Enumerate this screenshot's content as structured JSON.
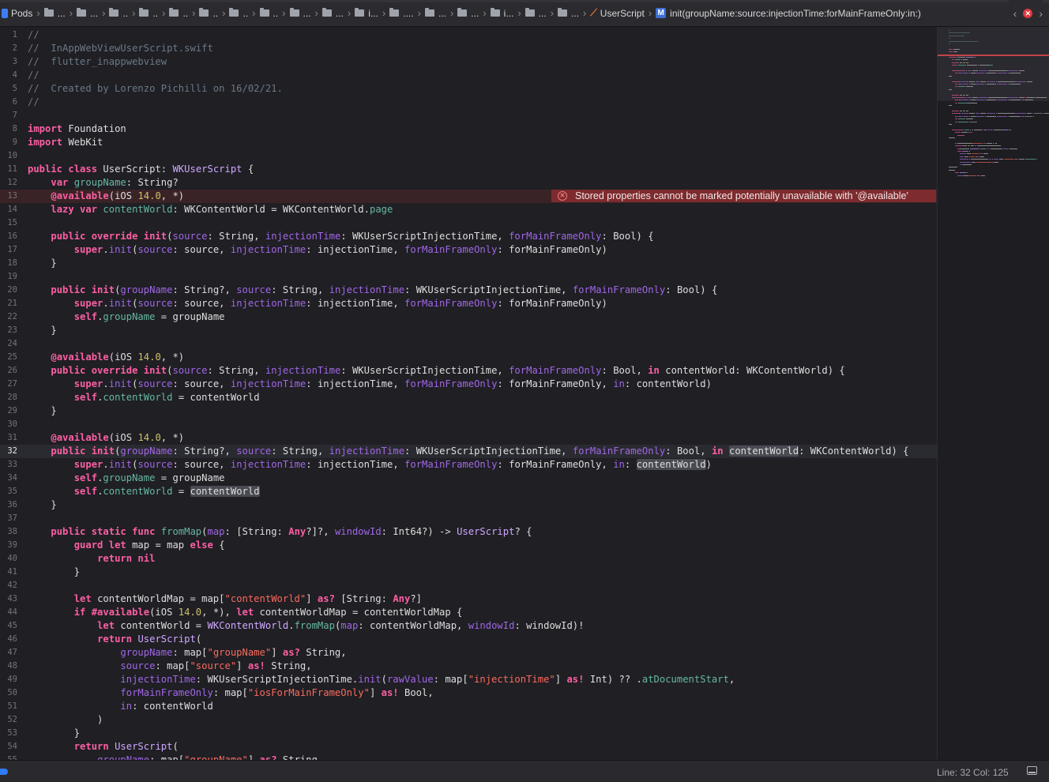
{
  "breadcrumb": {
    "root": "Pods",
    "folders": [
      "...",
      "...",
      "..",
      "..",
      "..",
      "..",
      "..",
      "..",
      "...",
      "...",
      "i...",
      "....",
      "...",
      "...",
      "i...",
      "...",
      "..."
    ],
    "file": "UserScript",
    "symbol": "init(groupName:source:injectionTime:forMainFrameOnly:in:)"
  },
  "error": {
    "line": 13,
    "message": "Stored properties cannot be marked potentially unavailable with '@available'"
  },
  "current_line": 32,
  "status": {
    "position": "Line: 32  Col: 125"
  },
  "colors": {
    "background": "#1f1f24",
    "keyword": "#fc5fa3",
    "comment": "#6c7986",
    "type": "#d0a8ff",
    "string": "#fc6a5d",
    "number": "#d0bf69",
    "error_bg": "#7d2b2e"
  },
  "code": [
    [
      [
        "cm",
        "//"
      ]
    ],
    [
      [
        "cm",
        "//  InAppWebViewUserScript.swift"
      ]
    ],
    [
      [
        "cm",
        "//  flutter_inappwebview"
      ]
    ],
    [
      [
        "cm",
        "//"
      ]
    ],
    [
      [
        "cm",
        "//  Created by Lorenzo Pichilli on 16/02/21."
      ]
    ],
    [
      [
        "cm",
        "//"
      ]
    ],
    [],
    [
      [
        "kw",
        "import"
      ],
      [
        "",
        "Foundation"
      ]
    ],
    [
      [
        "kw",
        "import"
      ],
      [
        "",
        "WebKit"
      ]
    ],
    [],
    [
      [
        "kw",
        "public class"
      ],
      [
        "",
        "UserScript"
      ],
      [
        "",
        ":"
      ],
      [
        "ty",
        "WKUserScript"
      ],
      [
        "",
        "{"
      ]
    ],
    [
      [
        "",
        "    "
      ],
      [
        "kw",
        "var"
      ],
      [
        "pj",
        "groupName"
      ],
      [
        "",
        ":"
      ],
      [
        "",
        "String?"
      ]
    ],
    [
      [
        "",
        "    "
      ],
      [
        "kw",
        "@available"
      ],
      [
        "",
        "(iOS"
      ],
      [
        "nm",
        "14.0"
      ],
      [
        "",
        ", *)"
      ]
    ],
    [
      [
        "",
        "    "
      ],
      [
        "kw",
        "lazy var"
      ],
      [
        "pj",
        "contentWorld"
      ],
      [
        "",
        ":"
      ],
      [
        "",
        "WKContentWorld"
      ],
      [
        "",
        "="
      ],
      [
        "",
        "WKContentWorld."
      ],
      [
        "pj",
        "page"
      ]
    ],
    [],
    [
      [
        "",
        "    "
      ],
      [
        "kw",
        "public override init"
      ],
      [
        "",
        "("
      ],
      [
        "lb",
        "source"
      ],
      [
        "",
        ":"
      ],
      [
        "",
        "String,"
      ],
      [
        "lb",
        "injectionTime"
      ],
      [
        "",
        ":"
      ],
      [
        "",
        "WKUserScriptInjectionTime,"
      ],
      [
        "lb",
        "forMainFrameOnly"
      ],
      [
        "",
        ":"
      ],
      [
        "",
        "Bool) {"
      ]
    ],
    [
      [
        "",
        "        "
      ],
      [
        "kw",
        "super"
      ],
      [
        "",
        "."
      ],
      [
        "lb",
        "init"
      ],
      [
        "",
        "("
      ],
      [
        "lb",
        "source"
      ],
      [
        "",
        ":"
      ],
      [
        "",
        "source,"
      ],
      [
        "lb",
        "injectionTime"
      ],
      [
        "",
        ":"
      ],
      [
        "",
        "injectionTime,"
      ],
      [
        "lb",
        "forMainFrameOnly"
      ],
      [
        "",
        ":"
      ],
      [
        "",
        "forMainFrameOnly)"
      ]
    ],
    [
      [
        "",
        "    }"
      ]
    ],
    [],
    [
      [
        "",
        "    "
      ],
      [
        "kw",
        "public init"
      ],
      [
        "",
        "("
      ],
      [
        "lb",
        "groupName"
      ],
      [
        "",
        ":"
      ],
      [
        "",
        "String?,"
      ],
      [
        "lb",
        "source"
      ],
      [
        "",
        ":"
      ],
      [
        "",
        "String,"
      ],
      [
        "lb",
        "injectionTime"
      ],
      [
        "",
        ":"
      ],
      [
        "",
        "WKUserScriptInjectionTime,"
      ],
      [
        "lb",
        "forMainFrameOnly"
      ],
      [
        "",
        ":"
      ],
      [
        "",
        "Bool) {"
      ]
    ],
    [
      [
        "",
        "        "
      ],
      [
        "kw",
        "super"
      ],
      [
        "",
        "."
      ],
      [
        "lb",
        "init"
      ],
      [
        "",
        "("
      ],
      [
        "lb",
        "source"
      ],
      [
        "",
        ":"
      ],
      [
        "",
        "source,"
      ],
      [
        "lb",
        "injectionTime"
      ],
      [
        "",
        ":"
      ],
      [
        "",
        "injectionTime,"
      ],
      [
        "lb",
        "forMainFrameOnly"
      ],
      [
        "",
        ":"
      ],
      [
        "",
        "forMainFrameOnly)"
      ]
    ],
    [
      [
        "",
        "        "
      ],
      [
        "kw",
        "self"
      ],
      [
        "",
        "."
      ],
      [
        "pj",
        "groupName"
      ],
      [
        "",
        "= groupName"
      ]
    ],
    [
      [
        "",
        "    }"
      ]
    ],
    [],
    [
      [
        "",
        "    "
      ],
      [
        "kw",
        "@available"
      ],
      [
        "",
        "(iOS"
      ],
      [
        "nm",
        "14.0"
      ],
      [
        "",
        ", *)"
      ]
    ],
    [
      [
        "",
        "    "
      ],
      [
        "kw",
        "public override init"
      ],
      [
        "",
        "("
      ],
      [
        "lb",
        "source"
      ],
      [
        "",
        ":"
      ],
      [
        "",
        "String,"
      ],
      [
        "lb",
        "injectionTime"
      ],
      [
        "",
        ":"
      ],
      [
        "",
        "WKUserScriptInjectionTime,"
      ],
      [
        "lb",
        "forMainFrameOnly"
      ],
      [
        "",
        ":"
      ],
      [
        "",
        "Bool,"
      ],
      [
        "kw",
        "in"
      ],
      [
        "",
        "contentWorld:"
      ],
      [
        "",
        "WKContentWorld) {"
      ]
    ],
    [
      [
        "",
        "        "
      ],
      [
        "kw",
        "super"
      ],
      [
        "",
        "."
      ],
      [
        "lb",
        "init"
      ],
      [
        "",
        "("
      ],
      [
        "lb",
        "source"
      ],
      [
        "",
        ":"
      ],
      [
        "",
        "source,"
      ],
      [
        "lb",
        "injectionTime"
      ],
      [
        "",
        ":"
      ],
      [
        "",
        "injectionTime,"
      ],
      [
        "lb",
        "forMainFrameOnly"
      ],
      [
        "",
        ":"
      ],
      [
        "",
        "forMainFrameOnly,"
      ],
      [
        "lb",
        "in"
      ],
      [
        "",
        ":"
      ],
      [
        "",
        "contentWorld)"
      ]
    ],
    [
      [
        "",
        "        "
      ],
      [
        "kw",
        "self"
      ],
      [
        "",
        "."
      ],
      [
        "pj",
        "contentWorld"
      ],
      [
        "",
        "= contentWorld"
      ]
    ],
    [
      [
        "",
        "    }"
      ]
    ],
    [],
    [
      [
        "",
        "    "
      ],
      [
        "kw",
        "@available"
      ],
      [
        "",
        "(iOS"
      ],
      [
        "nm",
        "14.0"
      ],
      [
        "",
        ", *)"
      ]
    ],
    [
      [
        "",
        "    "
      ],
      [
        "kw",
        "public init"
      ],
      [
        "",
        "("
      ],
      [
        "lb",
        "groupName"
      ],
      [
        "",
        ":"
      ],
      [
        "",
        "String?,"
      ],
      [
        "lb",
        "source"
      ],
      [
        "",
        ":"
      ],
      [
        "",
        "String,"
      ],
      [
        "lb",
        "injectionTime"
      ],
      [
        "",
        ":"
      ],
      [
        "",
        "WKUserScriptInjectionTime,"
      ],
      [
        "lb",
        "forMainFrameOnly"
      ],
      [
        "",
        ":"
      ],
      [
        "",
        "Bool,"
      ],
      [
        "kw",
        "in"
      ],
      [
        "hl",
        "contentWorld"
      ],
      [
        "",
        ":"
      ],
      [
        "",
        "WKContentWorld) {"
      ]
    ],
    [
      [
        "",
        "        "
      ],
      [
        "kw",
        "super"
      ],
      [
        "",
        "."
      ],
      [
        "lb",
        "init"
      ],
      [
        "",
        "("
      ],
      [
        "lb",
        "source"
      ],
      [
        "",
        ":"
      ],
      [
        "",
        "source,"
      ],
      [
        "lb",
        "injectionTime"
      ],
      [
        "",
        ":"
      ],
      [
        "",
        "injectionTime,"
      ],
      [
        "lb",
        "forMainFrameOnly"
      ],
      [
        "",
        ":"
      ],
      [
        "",
        "forMainFrameOnly,"
      ],
      [
        "lb",
        "in"
      ],
      [
        "",
        ":"
      ],
      [
        "hl",
        "contentWorld"
      ],
      [
        "",
        ")"
      ]
    ],
    [
      [
        "",
        "        "
      ],
      [
        "kw",
        "self"
      ],
      [
        "",
        "."
      ],
      [
        "pj",
        "groupName"
      ],
      [
        "",
        "= groupName"
      ]
    ],
    [
      [
        "",
        "        "
      ],
      [
        "kw",
        "self"
      ],
      [
        "",
        "."
      ],
      [
        "pj",
        "contentWorld"
      ],
      [
        "",
        "="
      ],
      [
        "hl",
        "contentWorld"
      ]
    ],
    [
      [
        "",
        "    }"
      ]
    ],
    [],
    [
      [
        "",
        "    "
      ],
      [
        "kw",
        "public static func"
      ],
      [
        "pj",
        "fromMap"
      ],
      [
        "",
        "("
      ],
      [
        "lb",
        "map"
      ],
      [
        "",
        ": [String:"
      ],
      [
        "kw",
        "Any"
      ],
      [
        "",
        "?]?,"
      ],
      [
        "lb",
        "windowId"
      ],
      [
        "",
        ":"
      ],
      [
        "",
        "Int64?) ->"
      ],
      [
        "ty",
        "UserScript"
      ],
      [
        "",
        "? {"
      ]
    ],
    [
      [
        "",
        "        "
      ],
      [
        "kw",
        "guard let"
      ],
      [
        "",
        "map = map"
      ],
      [
        "kw",
        "else"
      ],
      [
        "",
        "{"
      ]
    ],
    [
      [
        "",
        "            "
      ],
      [
        "kw",
        "return nil"
      ]
    ],
    [
      [
        "",
        "        }"
      ]
    ],
    [],
    [
      [
        "",
        "        "
      ],
      [
        "kw",
        "let"
      ],
      [
        "",
        "contentWorldMap = map["
      ],
      [
        "st",
        "\"contentWorld\""
      ],
      [
        "",
        "]"
      ],
      [
        "kw",
        "as?"
      ],
      [
        "",
        "[String:"
      ],
      [
        "kw",
        "Any"
      ],
      [
        "",
        "?]"
      ]
    ],
    [
      [
        "",
        "        "
      ],
      [
        "kw",
        "if #available"
      ],
      [
        "",
        "(iOS"
      ],
      [
        "nm",
        "14.0"
      ],
      [
        "",
        ", *),"
      ],
      [
        "kw",
        "let"
      ],
      [
        "",
        "contentWorldMap = contentWorldMap {"
      ]
    ],
    [
      [
        "",
        "            "
      ],
      [
        "kw",
        "let"
      ],
      [
        "",
        "contentWorld ="
      ],
      [
        "ty",
        "WKContentWorld"
      ],
      [
        "",
        "."
      ],
      [
        "pj",
        "fromMap"
      ],
      [
        "",
        "("
      ],
      [
        "lb",
        "map"
      ],
      [
        "",
        ": contentWorldMap,"
      ],
      [
        "lb",
        "windowId"
      ],
      [
        "",
        ": windowId)!"
      ]
    ],
    [
      [
        "",
        "            "
      ],
      [
        "kw",
        "return"
      ],
      [
        "ty",
        "UserScript"
      ],
      [
        "",
        "("
      ]
    ],
    [
      [
        "",
        "                "
      ],
      [
        "lb",
        "groupName"
      ],
      [
        "",
        ": map["
      ],
      [
        "st",
        "\"groupName\""
      ],
      [
        "",
        "]"
      ],
      [
        "kw",
        "as?"
      ],
      [
        "",
        "String,"
      ]
    ],
    [
      [
        "",
        "                "
      ],
      [
        "lb",
        "source"
      ],
      [
        "",
        ": map["
      ],
      [
        "st",
        "\"source\""
      ],
      [
        "",
        "]"
      ],
      [
        "kw",
        "as!"
      ],
      [
        "",
        "String,"
      ]
    ],
    [
      [
        "",
        "                "
      ],
      [
        "lb",
        "injectionTime"
      ],
      [
        "",
        ":"
      ],
      [
        "",
        "WKUserScriptInjectionTime."
      ],
      [
        "lb",
        "init"
      ],
      [
        "",
        "("
      ],
      [
        "lb",
        "rawValue"
      ],
      [
        "",
        ": map["
      ],
      [
        "st",
        "\"injectionTime\""
      ],
      [
        "",
        "]"
      ],
      [
        "kw",
        "as!"
      ],
      [
        "",
        "Int) ?? ."
      ],
      [
        "pj",
        "atDocumentStart"
      ],
      [
        "",
        ","
      ]
    ],
    [
      [
        "",
        "                "
      ],
      [
        "lb",
        "forMainFrameOnly"
      ],
      [
        "",
        ": map["
      ],
      [
        "st",
        "\"iosForMainFrameOnly\""
      ],
      [
        "",
        "]"
      ],
      [
        "kw",
        "as!"
      ],
      [
        "",
        "Bool,"
      ]
    ],
    [
      [
        "",
        "                "
      ],
      [
        "lb",
        "in"
      ],
      [
        "",
        ": contentWorld"
      ]
    ],
    [
      [
        "",
        "            )"
      ]
    ],
    [
      [
        "",
        "        }"
      ]
    ],
    [
      [
        "",
        "        "
      ],
      [
        "kw",
        "return"
      ],
      [
        "ty",
        "UserScript"
      ],
      [
        "",
        "("
      ]
    ],
    [
      [
        "",
        "            "
      ],
      [
        "lb",
        "groupName"
      ],
      [
        "",
        ": map["
      ],
      [
        "st",
        "\"groupName\""
      ],
      [
        "",
        "]"
      ],
      [
        "kw",
        "as?"
      ],
      [
        "",
        "String"
      ]
    ]
  ]
}
